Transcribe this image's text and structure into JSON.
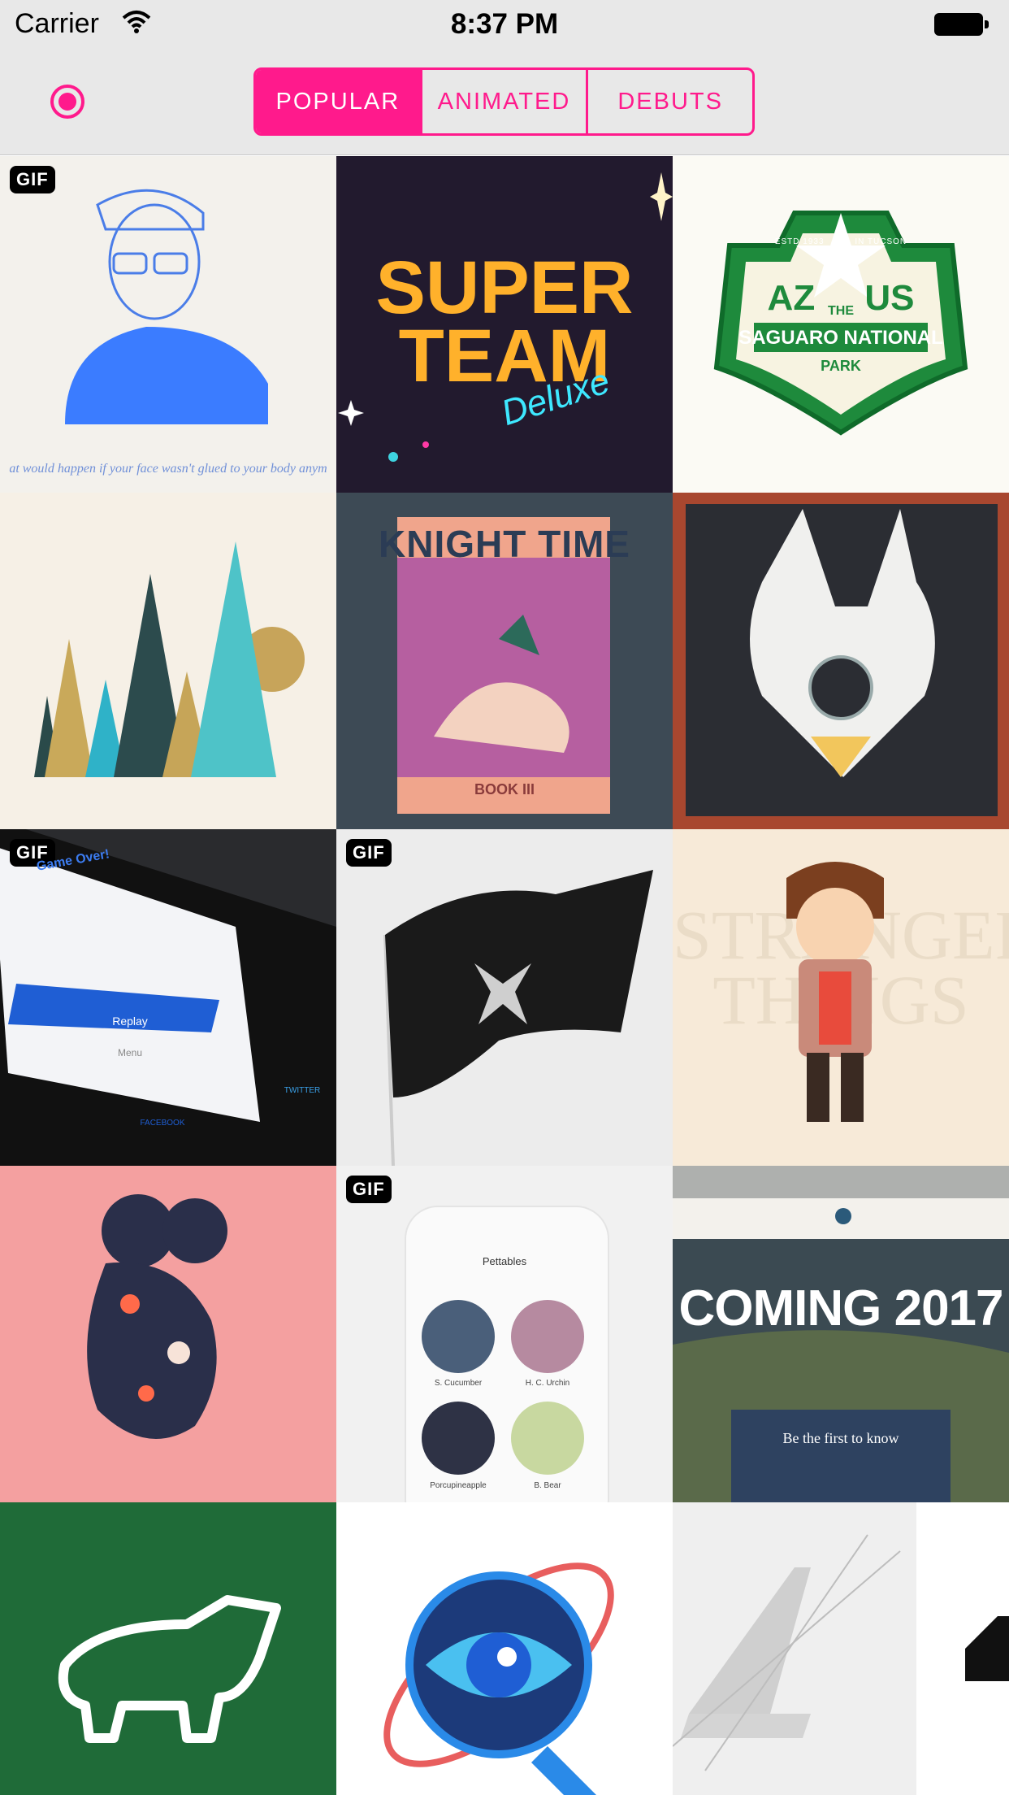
{
  "status_bar": {
    "carrier": "Carrier",
    "time": "8:37 PM"
  },
  "nav": {
    "tabs": [
      {
        "label": "POPULAR",
        "active": true
      },
      {
        "label": "ANIMATED",
        "active": false
      },
      {
        "label": "DEBUTS",
        "active": false
      }
    ],
    "accent_color": "#ff1a8c"
  },
  "shots": [
    {
      "gif": true,
      "gif_label": "GIF",
      "caption": "at would happen if your face wasn't glued to your body anym"
    },
    {
      "gif": false,
      "lines": [
        "SUPER",
        "TEAM",
        "Deluxe"
      ]
    },
    {
      "gif": false,
      "lines": [
        "ESTD 1933",
        "IN TUCSON",
        "AZ",
        "US",
        "THE",
        "SAGUARO NATIONAL",
        "PARK"
      ]
    },
    {
      "gif": false
    },
    {
      "gif": false,
      "lines": [
        "KNIGHT TIME",
        "BOOK III"
      ]
    },
    {
      "gif": false
    },
    {
      "gif": true,
      "gif_label": "GIF",
      "lines": [
        "Game Over!",
        "Replay",
        "Menu",
        "FACEBOOK",
        "TWITTER"
      ]
    },
    {
      "gif": true,
      "gif_label": "GIF"
    },
    {
      "gif": false,
      "lines": [
        "STRANGER",
        "THINGS"
      ]
    },
    {
      "gif": false
    },
    {
      "gif": true,
      "gif_label": "GIF",
      "lines": [
        "Pettables",
        "S. Cucumber",
        "H. C. Urchin",
        "Porcupineapple",
        "B. Bear"
      ]
    },
    {
      "gif": false,
      "lines": [
        "COMING 2017",
        "Be the first to know"
      ]
    },
    {
      "gif": false
    },
    {
      "gif": false
    },
    {
      "gif": false
    },
    {
      "gif": false
    }
  ]
}
